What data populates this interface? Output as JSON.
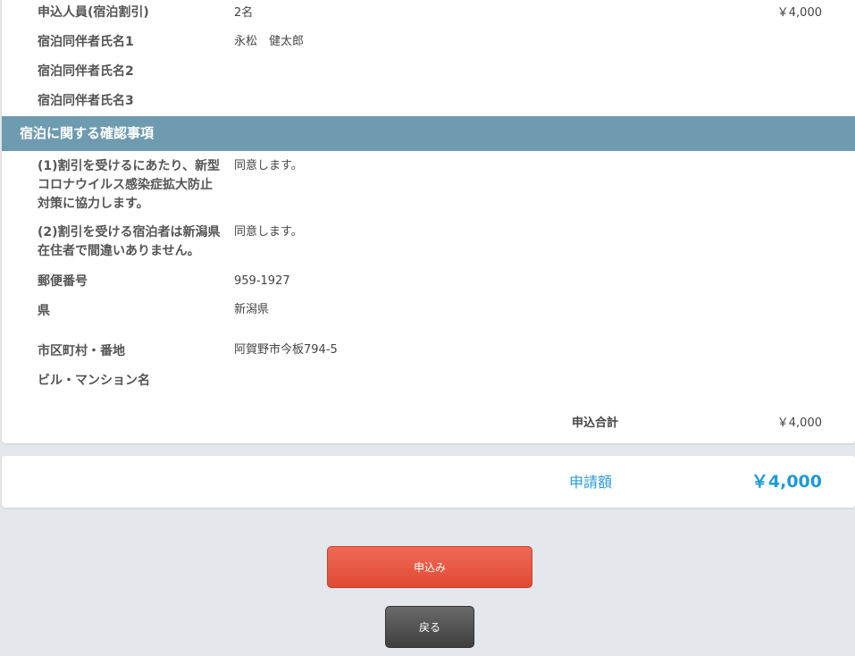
{
  "details": {
    "rows": [
      {
        "label": "申込人員(宿泊割引)",
        "value": "2名",
        "price": "￥4,000"
      },
      {
        "label": "宿泊同伴者氏名1",
        "value": "永松　健太郎"
      },
      {
        "label": "宿泊同伴者氏名2",
        "value": ""
      },
      {
        "label": "宿泊同伴者氏名3",
        "value": ""
      }
    ],
    "section_title": "宿泊に関する確認事項",
    "confirmations": [
      {
        "label_lines": [
          "(1)割引を受けるにあたり、新型",
          "コロナウイルス感染症拡大防止",
          "対策に協力します。"
        ],
        "value": "同意します。"
      },
      {
        "label_lines": [
          "(2)割引を受ける宿泊者は新潟県",
          "在住者で間違いありません。"
        ],
        "value": "同意します。"
      }
    ],
    "address": [
      {
        "label": "郵便番号",
        "value": "959-1927"
      },
      {
        "label": "県",
        "value": "新潟県"
      },
      {
        "label": "市区町村・番地",
        "value": "阿賀野市今板794-5"
      },
      {
        "label": "ビル・マンション名",
        "value": ""
      }
    ],
    "total_label": "申込合計",
    "total_value": "￥4,000"
  },
  "amount": {
    "label": "申請額",
    "value": "￥4,000"
  },
  "buttons": {
    "submit": "申込み",
    "back": "戻る"
  }
}
